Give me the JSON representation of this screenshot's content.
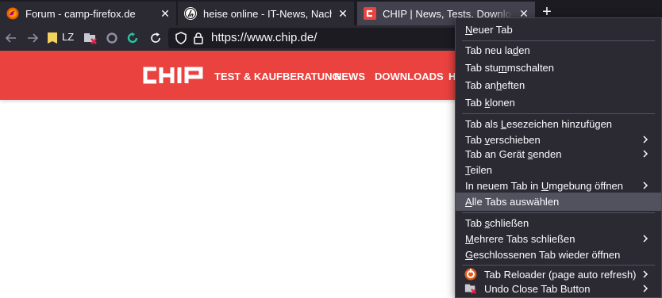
{
  "tabs": [
    {
      "title": "Forum - camp-firefox.de",
      "favicon": "firefox-logo-icon",
      "active": false
    },
    {
      "title": "heise online - IT-News, Nachrichten",
      "favicon": "heise-logo-icon",
      "active": false
    },
    {
      "title": "CHIP | News, Tests, Downloads",
      "favicon": "chip-logo-icon",
      "active": true
    }
  ],
  "newtab_symbol": "+",
  "close_symbol": "✕",
  "nav": {
    "bookmark_label": "LZ",
    "url": "https://www.chip.de/"
  },
  "page": {
    "logo_text": "CHIP",
    "nav_items": [
      "TEST & KAUFBERATUNG",
      "NEWS",
      "DOWNLOADS",
      "H"
    ],
    "brand_color": "#e9423f"
  },
  "menu": {
    "items": {
      "new_tab": {
        "pre": "",
        "key": "N",
        "post": "euer Tab"
      },
      "reload": {
        "pre": "Tab neu la",
        "key": "d",
        "post": "en"
      },
      "mute": {
        "pre": "Tab stu",
        "key": "m",
        "post": "mschalten"
      },
      "pin": {
        "pre": "Tab an",
        "key": "h",
        "post": "eften"
      },
      "duplicate": {
        "pre": "Tab ",
        "key": "k",
        "post": "lonen"
      },
      "bookmark": {
        "pre": "Tab als ",
        "key": "L",
        "post": "esezeichen hinzufügen"
      },
      "move": {
        "pre": "Tab ",
        "key": "v",
        "post": "erschieben"
      },
      "send": {
        "pre": "Tab an Gerät ",
        "key": "s",
        "post": "enden"
      },
      "share": {
        "pre": "",
        "key": "T",
        "post": "eilen"
      },
      "container": {
        "pre": "In neuem Tab in ",
        "key": "U",
        "post": "mgebung öffnen"
      },
      "select_all": {
        "pre": "",
        "key": "A",
        "post": "lle Tabs auswählen"
      },
      "close": {
        "pre": "Tab ",
        "key": "s",
        "post": "chließen"
      },
      "close_multiple": {
        "pre": "",
        "key": "M",
        "post": "ehrere Tabs schließen"
      },
      "reopen": {
        "pre": "",
        "key": "G",
        "post": "eschlossenen Tab wieder öffnen"
      },
      "tab_reloader": {
        "label": "Tab Reloader (page auto refresh)"
      },
      "undo_close": {
        "label": "Undo Close Tab Button"
      }
    }
  }
}
